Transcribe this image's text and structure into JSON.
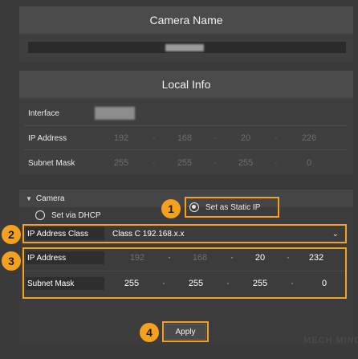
{
  "camera_name": {
    "title": "Camera Name"
  },
  "local_info": {
    "title": "Local Info",
    "interface_label": "Interface",
    "ip_address_label": "IP Address",
    "ip_address": [
      "192",
      "168",
      "20",
      "226"
    ],
    "subnet_mask_label": "Subnet Mask",
    "subnet_mask": [
      "255",
      "255",
      "255",
      "0"
    ]
  },
  "camera": {
    "section_label": "Camera",
    "dhcp_label": "Set via DHCP",
    "static_label": "Set as Static IP",
    "selected_mode": "static",
    "ip_class_label": "IP Address Class",
    "ip_class_value": "Class C 192.168.x.x",
    "ip_address_label": "IP Address",
    "ip_address": [
      "192",
      "168",
      "20",
      "232"
    ],
    "subnet_mask_label": "Subnet Mask",
    "subnet_mask": [
      "255",
      "255",
      "255",
      "0"
    ],
    "apply_label": "Apply"
  },
  "callouts": [
    "1",
    "2",
    "3",
    "4"
  ],
  "colors": {
    "accent": "#f4a21d",
    "background": "#3a3a3a",
    "header": "#4b4b4b"
  },
  "icons": {
    "collapse": "triangle-down-icon",
    "dropdown": "chevron-down-icon"
  },
  "watermark": "MECH MIND"
}
